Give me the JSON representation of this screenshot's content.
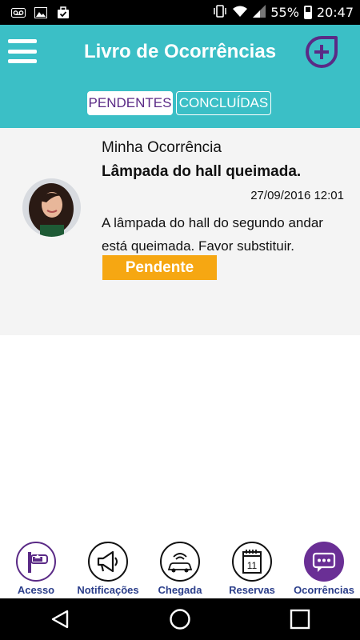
{
  "status_bar": {
    "battery": "55%",
    "time": "20:47",
    "left_icons": [
      "voicemail-icon",
      "image-icon",
      "briefcase-check-icon"
    ],
    "right_icons": [
      "vibrate-icon",
      "wifi-icon",
      "signal-icon",
      "battery-icon"
    ]
  },
  "header": {
    "title": "Livro de Ocorrências",
    "tabs": [
      {
        "label": "PENDENTES",
        "active": true
      },
      {
        "label": "CONCLUÍDAS",
        "active": false
      }
    ]
  },
  "occurrences": [
    {
      "kind": "Minha Ocorrência",
      "title": "Lâmpada do hall queimada.",
      "date": "27/09/2016 12:01",
      "description": "A lâmpada do hall do segundo andar está queimada. Favor substituir.",
      "status": "Pendente"
    }
  ],
  "bottom_nav": [
    {
      "label": "Acesso",
      "icon": "gate-icon"
    },
    {
      "label": "Notificações",
      "icon": "megaphone-icon"
    },
    {
      "label": "Chegada",
      "icon": "car-signal-icon"
    },
    {
      "label": "Reservas",
      "icon": "calendar-icon",
      "icon_text": "11"
    },
    {
      "label": "Ocorrências",
      "icon": "chat-icon",
      "active": true
    }
  ],
  "colors": {
    "header": "#3bbfc6",
    "accent": "#5a2a86",
    "badge": "#f6a712",
    "nav_label": "#2b3e8a"
  }
}
